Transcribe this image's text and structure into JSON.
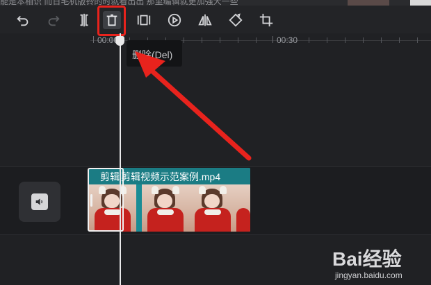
{
  "top_strip": {
    "text": "能是本相识 而日毛机版铃的时就看出出 那里编辑就更加强大一些"
  },
  "toolbar": {
    "tools": [
      {
        "name": "undo",
        "icon": "undo-icon",
        "enabled": true
      },
      {
        "name": "redo",
        "icon": "redo-icon",
        "enabled": false
      },
      {
        "name": "split",
        "icon": "split-icon",
        "enabled": true
      },
      {
        "name": "delete",
        "icon": "delete-icon",
        "enabled": true,
        "active": true
      },
      {
        "name": "freeze",
        "icon": "freeze-frame-icon",
        "enabled": true
      },
      {
        "name": "play",
        "icon": "play-icon",
        "enabled": true
      },
      {
        "name": "mirror",
        "icon": "mirror-icon",
        "enabled": true
      },
      {
        "name": "rotate",
        "icon": "rotate-icon",
        "enabled": true
      },
      {
        "name": "crop",
        "icon": "crop-icon",
        "enabled": true
      }
    ],
    "highlight_color": "#e8231d"
  },
  "ruler": {
    "labels": [
      "00:00",
      "00:30"
    ]
  },
  "tooltip": {
    "text": "删除(Del)"
  },
  "timeline": {
    "clip_title_left": "剪辑",
    "clip_title": "剪辑视频示范案例.mp4",
    "frame_captions": [
      "",
      "",
      "",
      ""
    ]
  },
  "audio": {
    "icon": "speaker-icon"
  },
  "watermark": {
    "brand": "Bai经验",
    "site": "jingyan.baidu.com"
  },
  "colors": {
    "accent": "#1a8c95",
    "arrow": "#e8231d"
  }
}
